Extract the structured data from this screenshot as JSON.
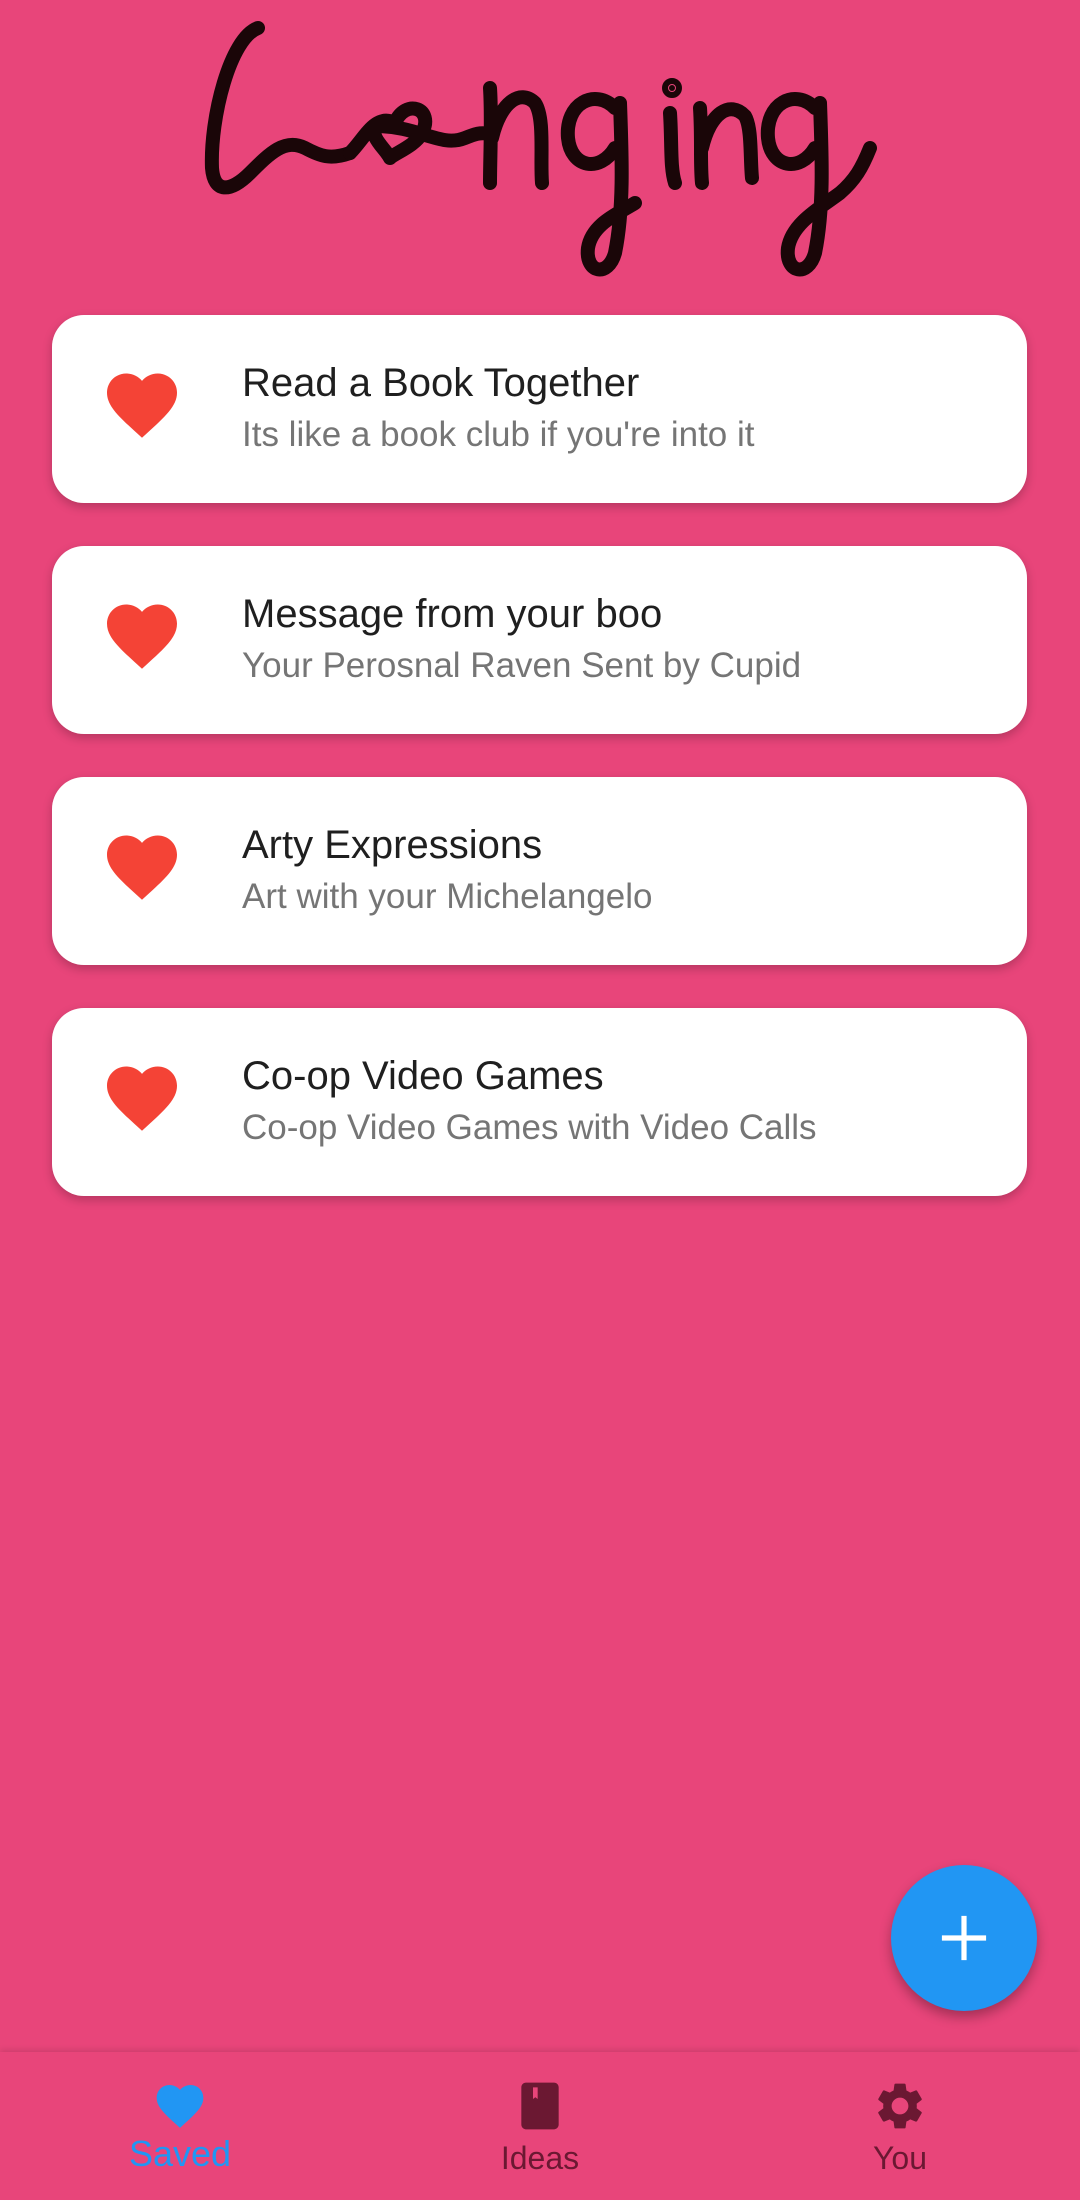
{
  "app": {
    "logo_text": "Longing"
  },
  "colors": {
    "background": "#E8457A",
    "card": "#FFFFFF",
    "heart": "#F44336",
    "fab": "#2196F3",
    "nav_active": "#2196F3",
    "nav_inactive": "#6B1832",
    "logo_ink": "#1A0608"
  },
  "cards": [
    {
      "icon": "heart-icon",
      "title": "Read a Book Together",
      "subtitle": "Its like a book club if you're into it"
    },
    {
      "icon": "heart-icon",
      "title": "Message from your boo",
      "subtitle": "Your Perosnal Raven Sent by Cupid"
    },
    {
      "icon": "heart-icon",
      "title": "Arty Expressions",
      "subtitle": "Art with your Michelangelo"
    },
    {
      "icon": "heart-icon",
      "title": "Co-op Video Games",
      "subtitle": "Co-op Video Games with Video Calls"
    }
  ],
  "fab": {
    "icon": "plus-icon"
  },
  "bottom_nav": {
    "items": [
      {
        "icon": "heart-icon",
        "label": "Saved",
        "active": true
      },
      {
        "icon": "book-icon",
        "label": "Ideas",
        "active": false
      },
      {
        "icon": "gear-icon",
        "label": "You",
        "active": false
      }
    ]
  }
}
